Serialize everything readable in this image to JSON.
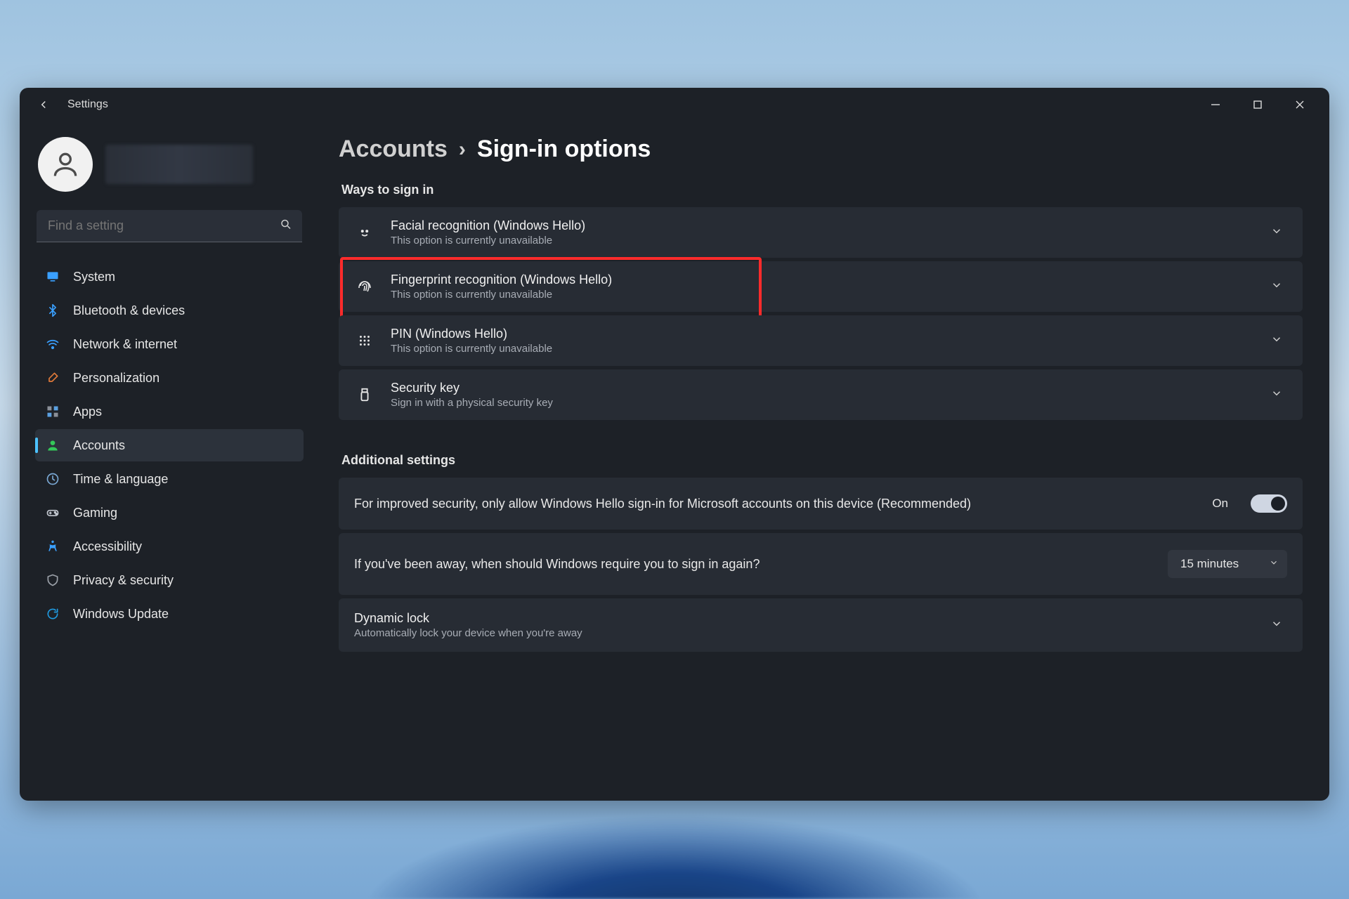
{
  "window": {
    "title": "Settings"
  },
  "search": {
    "placeholder": "Find a setting"
  },
  "sidebar": {
    "items": [
      {
        "label": "System",
        "icon": "monitor",
        "color": "#3aa0ff"
      },
      {
        "label": "Bluetooth & devices",
        "icon": "bluetooth",
        "color": "#3aa0ff"
      },
      {
        "label": "Network & internet",
        "icon": "wifi",
        "color": "#3aa0ff"
      },
      {
        "label": "Personalization",
        "icon": "brush",
        "color": "#e07a3a"
      },
      {
        "label": "Apps",
        "icon": "apps",
        "color": "#8a8f98"
      },
      {
        "label": "Accounts",
        "icon": "person",
        "color": "#34c759",
        "active": true
      },
      {
        "label": "Time & language",
        "icon": "clock",
        "color": "#7aa8d4"
      },
      {
        "label": "Gaming",
        "icon": "gamepad",
        "color": "#c2c7cf"
      },
      {
        "label": "Accessibility",
        "icon": "accessibility",
        "color": "#3aa0ff"
      },
      {
        "label": "Privacy & security",
        "icon": "shield",
        "color": "#9aa0a8"
      },
      {
        "label": "Windows Update",
        "icon": "update",
        "color": "#1f9ae0"
      }
    ]
  },
  "breadcrumb": {
    "parent": "Accounts",
    "current": "Sign-in options"
  },
  "sections": {
    "ways_header": "Ways to sign in",
    "additional_header": "Additional settings"
  },
  "signin_options": [
    {
      "title": "Facial recognition (Windows Hello)",
      "desc": "This option is currently unavailable",
      "icon": "face"
    },
    {
      "title": "Fingerprint recognition (Windows Hello)",
      "desc": "This option is currently unavailable",
      "icon": "fingerprint",
      "highlighted": true
    },
    {
      "title": "PIN (Windows Hello)",
      "desc": "This option is currently unavailable",
      "icon": "keypad"
    },
    {
      "title": "Security key",
      "desc": "Sign in with a physical security key",
      "icon": "usbkey"
    }
  ],
  "additional": {
    "hello_only": {
      "label": "For improved security, only allow Windows Hello sign-in for Microsoft accounts on this device (Recommended)",
      "state_text": "On"
    },
    "reauth": {
      "label": "If you've been away, when should Windows require you to sign in again?",
      "value": "15 minutes"
    },
    "dynamic_lock": {
      "title": "Dynamic lock",
      "desc": "Automatically lock your device when you're away"
    }
  }
}
